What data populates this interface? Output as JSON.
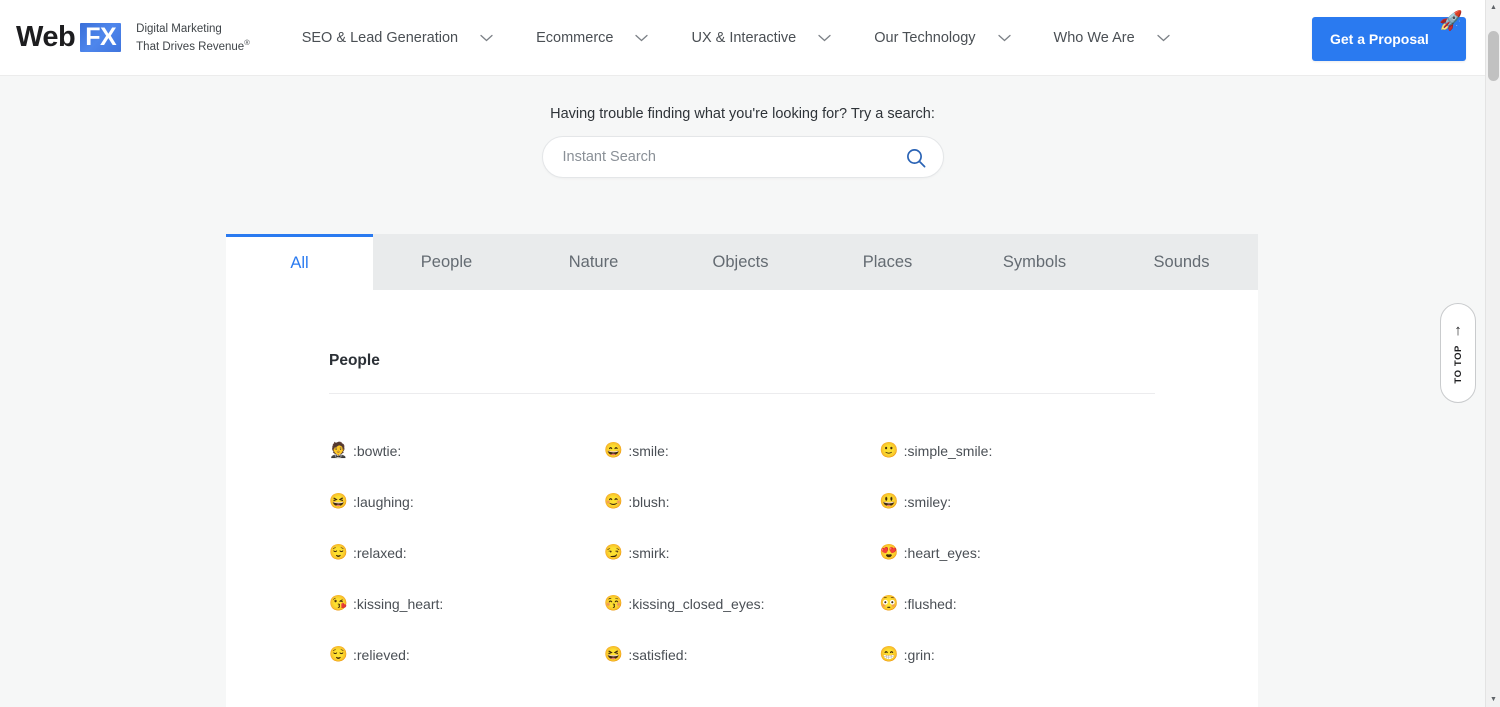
{
  "header": {
    "logo": {
      "word1": "Web",
      "word2": "FX"
    },
    "tagline_line1": "Digital Marketing",
    "tagline_line2": "That Drives Revenue",
    "tagline_mark": "®",
    "nav_items": [
      {
        "label": "SEO & Lead Generation",
        "icon": "chevron-down-icon"
      },
      {
        "label": "Ecommerce",
        "icon": "chevron-down-icon"
      },
      {
        "label": "UX & Interactive",
        "icon": "chevron-down-icon"
      },
      {
        "label": "Our Technology",
        "icon": "chevron-down-icon"
      },
      {
        "label": "Who We Are",
        "icon": "chevron-down-icon"
      }
    ],
    "cta": {
      "label": "Get a Proposal",
      "icon": "rocket-icon",
      "glyph": "🚀",
      "color": "#2a7af0"
    }
  },
  "search": {
    "prompt": "Having trouble finding what you're looking for? Try a search:",
    "placeholder": "Instant Search",
    "value": "",
    "icon": "search-icon",
    "icon_color": "#2a63b5"
  },
  "tabs": {
    "active": "All",
    "accent_color": "#2a7af0",
    "items": [
      {
        "label": "All",
        "active": true
      },
      {
        "label": "People",
        "active": false
      },
      {
        "label": "Nature",
        "active": false
      },
      {
        "label": "Objects",
        "active": false
      },
      {
        "label": "Places",
        "active": false
      },
      {
        "label": "Symbols",
        "active": false
      },
      {
        "label": "Sounds",
        "active": false
      }
    ]
  },
  "section": {
    "title": "People",
    "emojis": [
      {
        "glyph": "🤵",
        "code": ":bowtie:"
      },
      {
        "glyph": "😄",
        "code": ":smile:"
      },
      {
        "glyph": "🙂",
        "code": ":simple_smile:"
      },
      {
        "glyph": "😆",
        "code": ":laughing:"
      },
      {
        "glyph": "😊",
        "code": ":blush:"
      },
      {
        "glyph": "😃",
        "code": ":smiley:"
      },
      {
        "glyph": "😌",
        "code": ":relaxed:"
      },
      {
        "glyph": "😏",
        "code": ":smirk:"
      },
      {
        "glyph": "😍",
        "code": ":heart_eyes:"
      },
      {
        "glyph": "😘",
        "code": ":kissing_heart:"
      },
      {
        "glyph": "😚",
        "code": ":kissing_closed_eyes:"
      },
      {
        "glyph": "😳",
        "code": ":flushed:"
      },
      {
        "glyph": "😌",
        "code": ":relieved:"
      },
      {
        "glyph": "😆",
        "code": ":satisfied:"
      },
      {
        "glyph": "😁",
        "code": ":grin:"
      }
    ]
  },
  "to_top": {
    "label": "TO TOP",
    "icon": "arrow-up-icon",
    "glyph": "↑"
  },
  "scrollbar": {
    "up_glyph": "▲",
    "down_glyph": "▼"
  }
}
